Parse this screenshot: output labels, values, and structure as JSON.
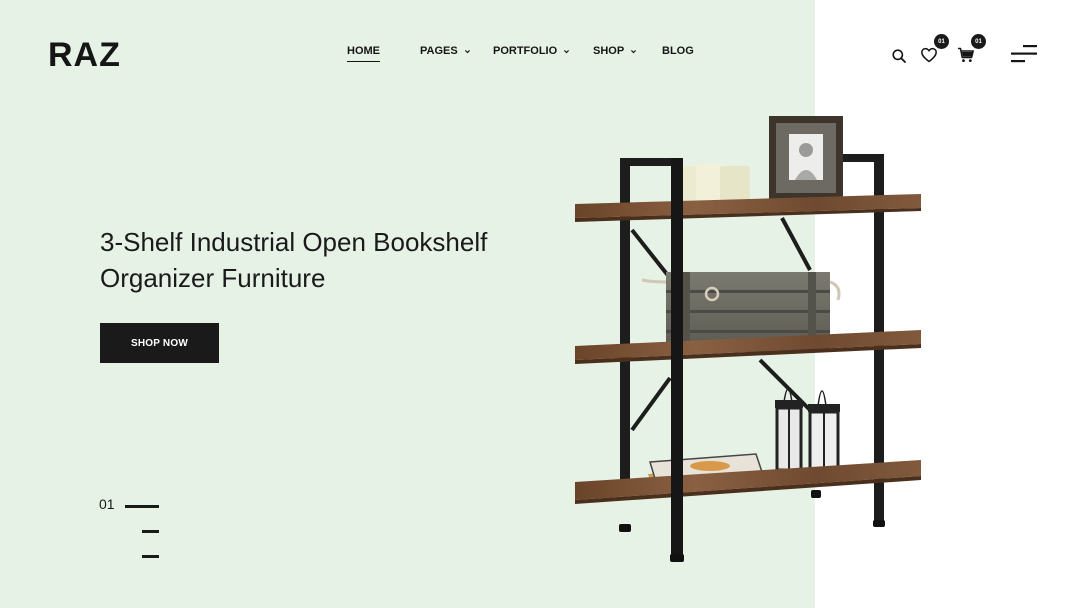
{
  "brand": {
    "logo": "RAZ"
  },
  "nav": {
    "items": [
      {
        "label": "HOME",
        "active": true,
        "has_dropdown": false
      },
      {
        "label": "PAGES",
        "active": false,
        "has_dropdown": true
      },
      {
        "label": "PORTFOLIO",
        "active": false,
        "has_dropdown": true
      },
      {
        "label": "SHOP",
        "active": false,
        "has_dropdown": true
      },
      {
        "label": "BLOG",
        "active": false,
        "has_dropdown": false
      }
    ]
  },
  "header_icons": {
    "search": "search-icon",
    "wishlist": {
      "icon": "heart-icon",
      "count": "01"
    },
    "cart": {
      "icon": "cart-icon",
      "count": "01"
    },
    "menu": "hamburger-menu-icon"
  },
  "hero": {
    "title": "3-Shelf Industrial Open Bookshelf Organizer Furniture",
    "button_label": "SHOP NOW",
    "slide_number": "01",
    "slide_count": 3,
    "active_slide": 1
  },
  "colors": {
    "mint_background": "#e7f2e6",
    "dark": "#1a1a1a",
    "white": "#ffffff",
    "wood": "#7a5236"
  }
}
